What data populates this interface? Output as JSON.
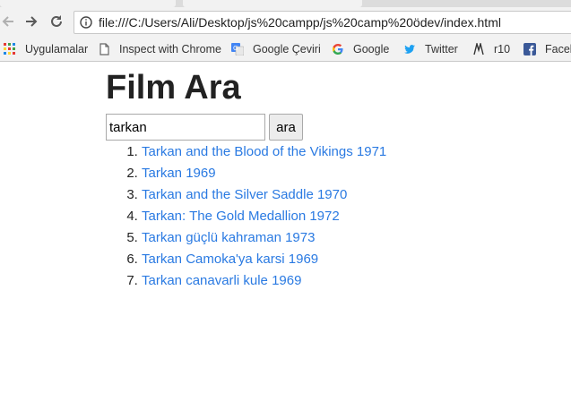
{
  "browser": {
    "address": "file:///C:/Users/Ali/Desktop/js%20campp/js%20camp%20ödev/index.html",
    "bookmarks": [
      {
        "label": "Uygulamalar",
        "icon": "apps-grid-icon"
      },
      {
        "label": "Inspect with Chrome",
        "icon": "page-icon"
      },
      {
        "label": "Google Çeviri",
        "icon": "translate-icon"
      },
      {
        "label": "Google",
        "icon": "google-icon"
      },
      {
        "label": "Twitter",
        "icon": "twitter-icon"
      },
      {
        "label": "r10",
        "icon": "r10-icon"
      },
      {
        "label": "Faceb",
        "icon": "facebook-icon"
      }
    ]
  },
  "page": {
    "title": "Film Ara",
    "search": {
      "value": "tarkan",
      "button_label": "ara"
    },
    "results": [
      "Tarkan and the Blood of the Vikings 1971",
      "Tarkan 1969",
      "Tarkan and the Silver Saddle 1970",
      "Tarkan: The Gold Medallion 1972",
      "Tarkan güçlü kahraman 1973",
      "Tarkan Camoka'ya karsi 1969",
      "Tarkan canavarli kule 1969"
    ]
  },
  "colors": {
    "link": "#2a7ae2",
    "twitter": "#1da1f2",
    "facebook": "#3b5998"
  }
}
